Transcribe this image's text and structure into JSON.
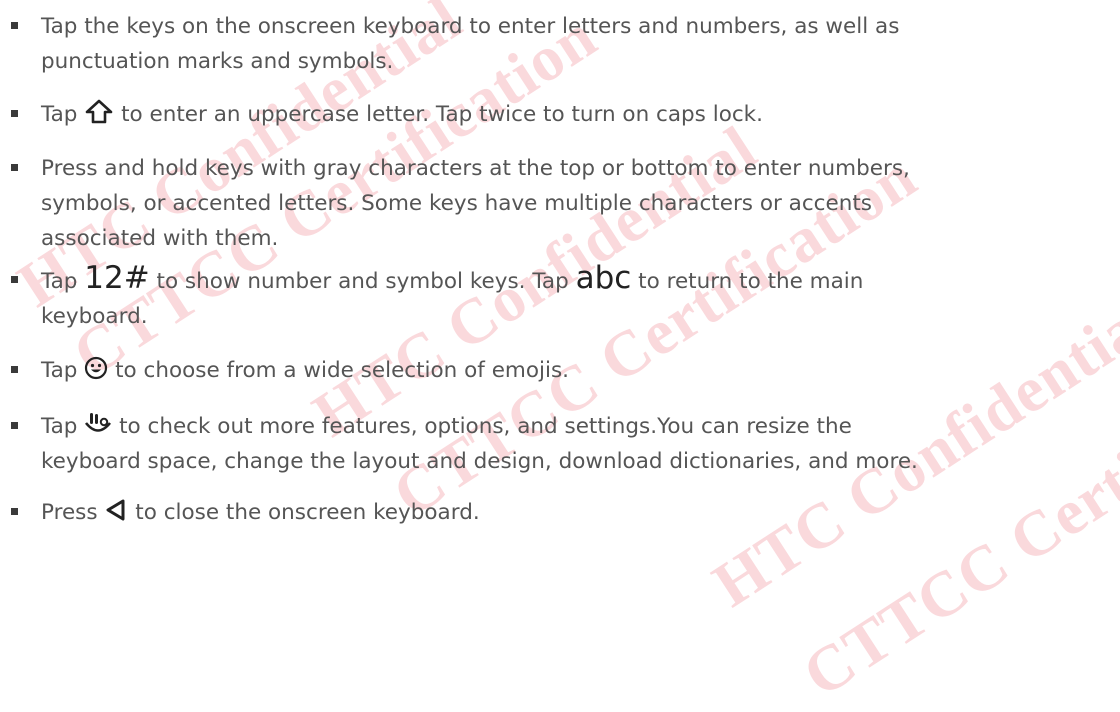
{
  "watermark": {
    "line1": "HTC Confidential",
    "line2": "CTTCC Certification"
  },
  "items": [
    {
      "lines": [
        "Tap the keys on the onscreen keyboard to enter letters and numbers, as well as",
        "punctuation marks and symbols."
      ]
    },
    {
      "pre": "Tap",
      "icon": "shift-arrow-icon",
      "post": "to enter an uppercase letter. Tap twice to turn on caps lock."
    },
    {
      "lines": [
        "Press and hold keys with gray characters at the top or bottom to enter numbers,",
        "symbols, or accented letters. Some keys have multiple characters or accents",
        "associated with them."
      ]
    },
    {
      "pre": "Tap",
      "key1": "12#",
      "mid": "to show number and symbol keys. Tap",
      "key2": "abc",
      "post": "to return to the main",
      "line2": "keyboard."
    },
    {
      "pre": "Tap",
      "icon": "smiley-icon",
      "post": "to choose from a wide selection of emojis."
    },
    {
      "pre": "Tap",
      "icon": "keyboard-menu-icon",
      "post": "to check out more features, options, and settings.You can resize the",
      "line2": "keyboard space, change the layout and design, download dictionaries, and more."
    },
    {
      "pre": "Press",
      "icon": "back-triangle-icon",
      "post": "to close the onscreen keyboard."
    }
  ]
}
